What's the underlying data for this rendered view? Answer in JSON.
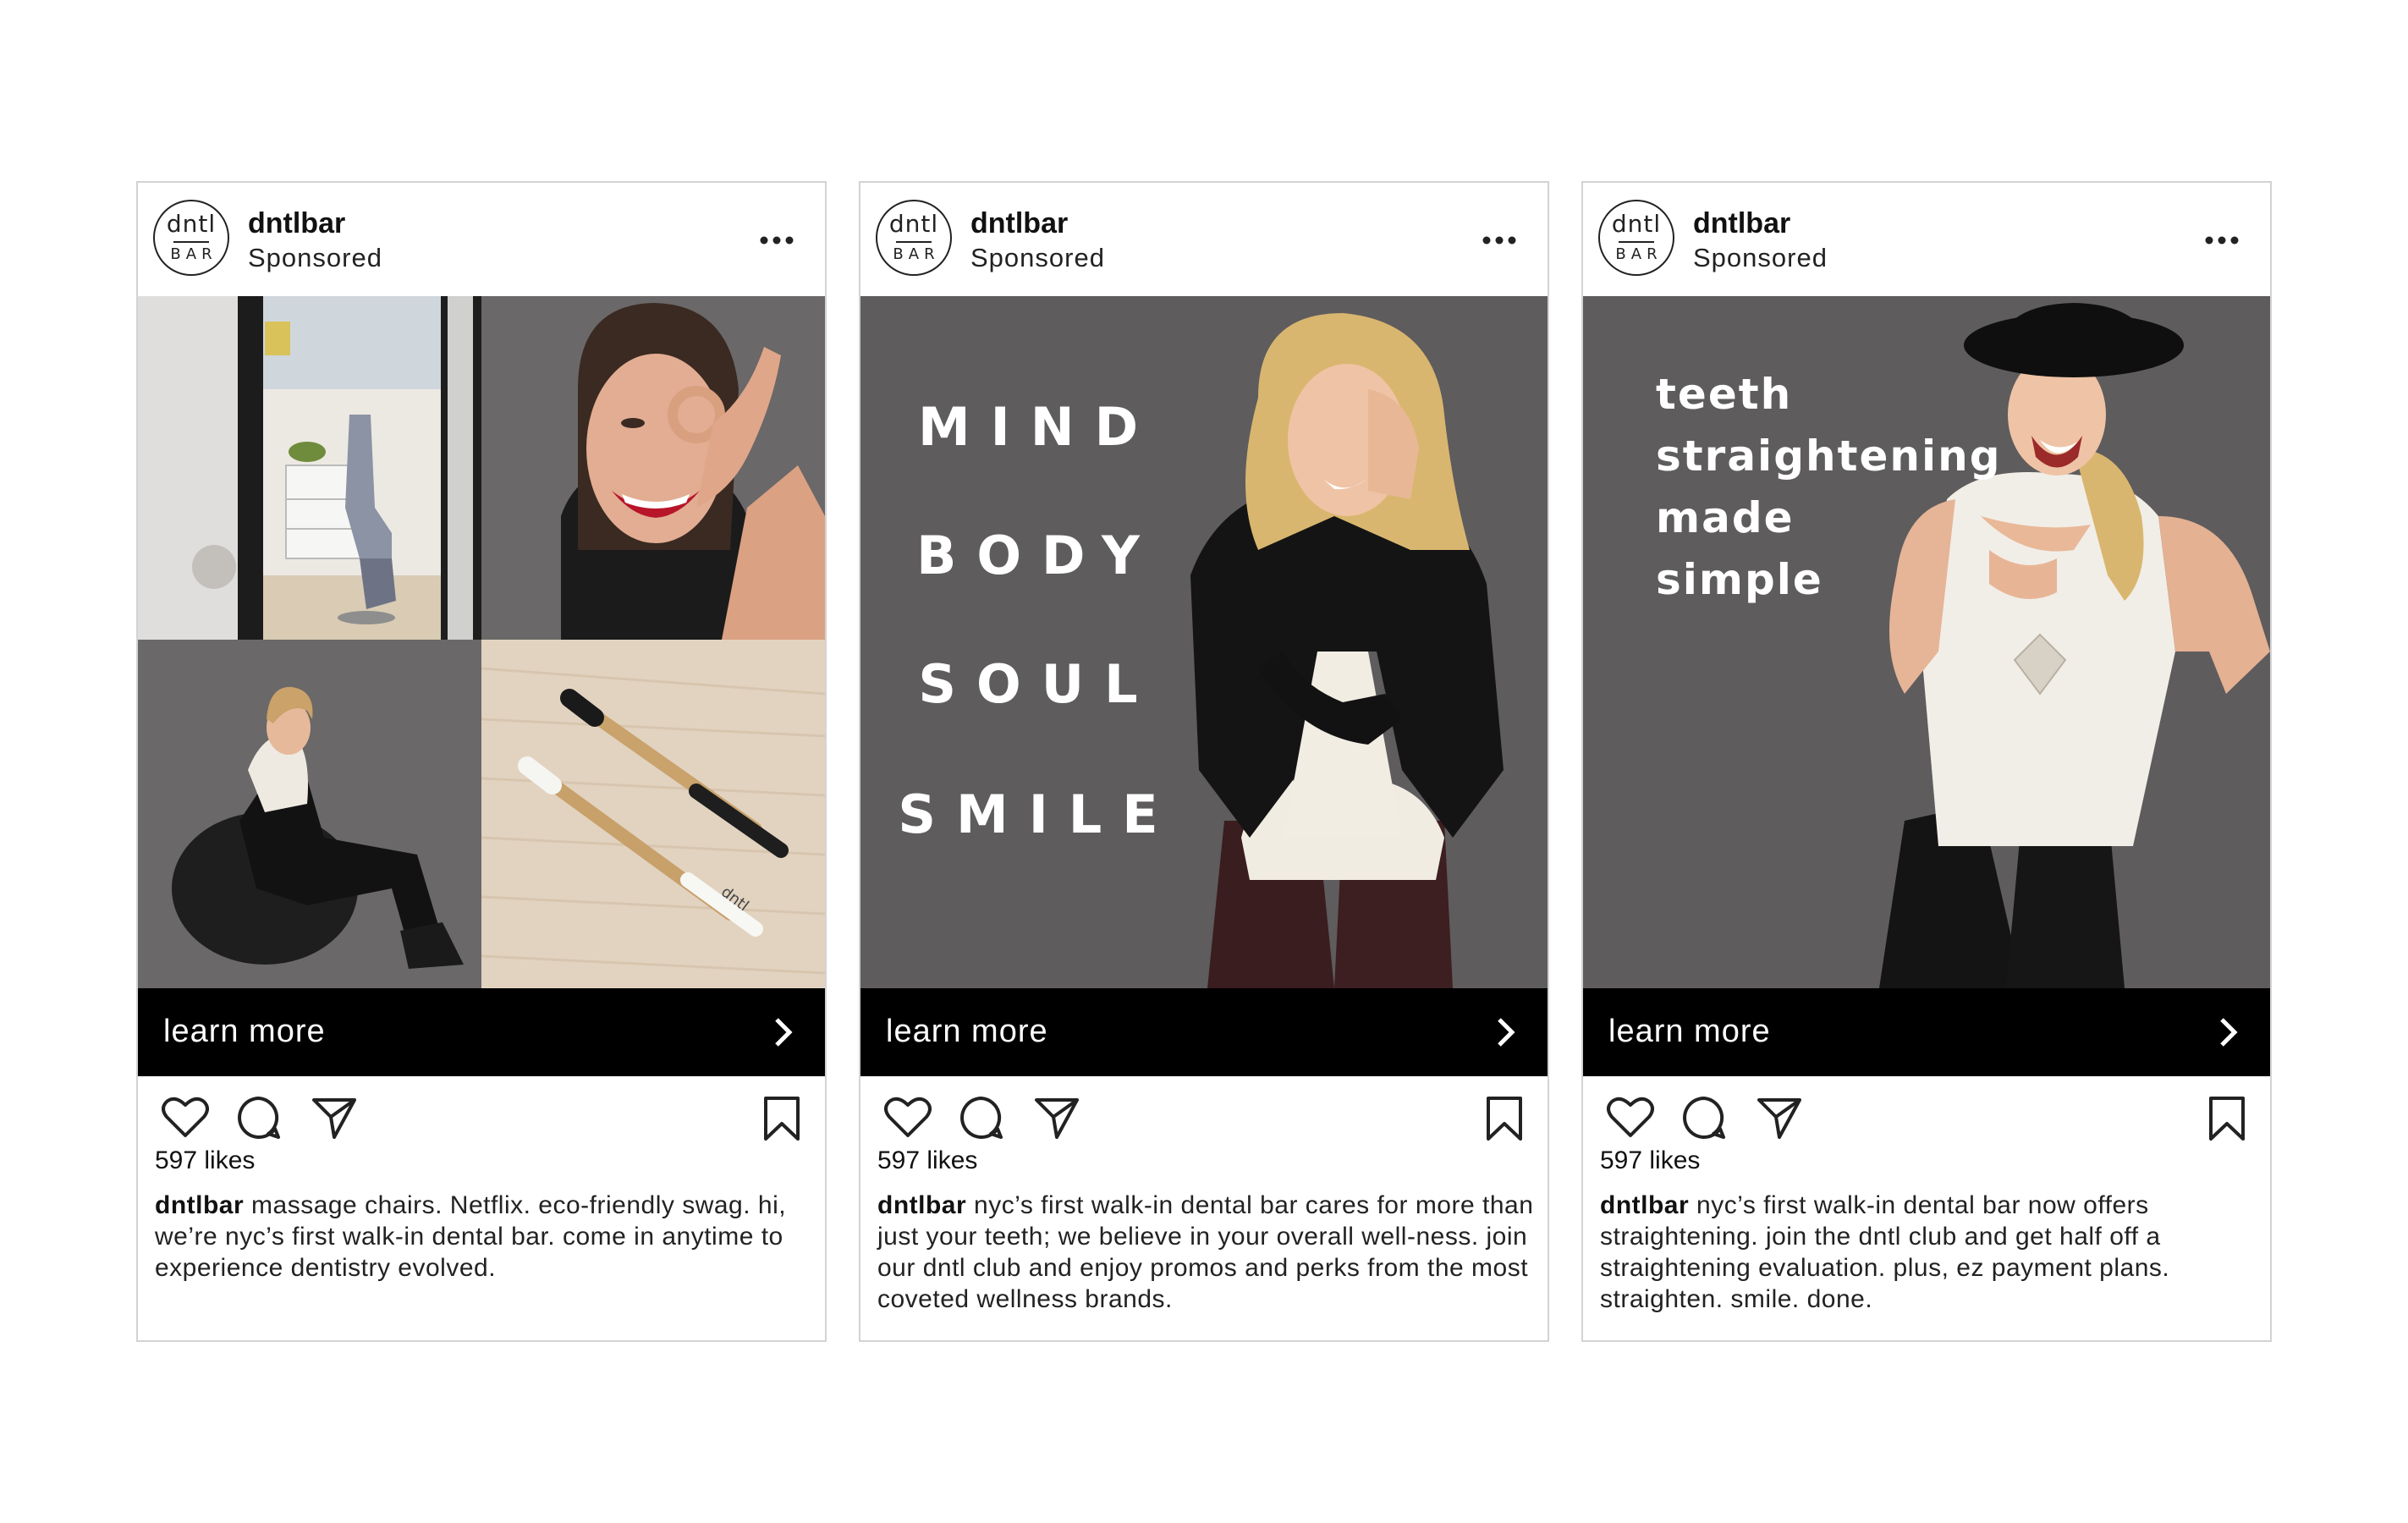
{
  "posts": [
    {
      "account": {
        "name": "dntlbar",
        "sponsored": "Sponsored",
        "logo_top": "dntl",
        "logo_bottom": "BAR"
      },
      "cta": "learn more",
      "likes": "597 likes",
      "caption_user": "dntlbar",
      "caption_text": "massage chairs. Netflix. eco-friendly swag. hi, we’re nyc’s first walk-in dental bar. come in anytime to experience dentistry evolved.",
      "toothbrush_label": "dntl",
      "photo": "collage: dental office, smiling woman, seated woman, bamboo toothbrushes"
    },
    {
      "account": {
        "name": "dntlbar",
        "sponsored": "Sponsored",
        "logo_top": "dntl",
        "logo_bottom": "BAR"
      },
      "cta": "learn more",
      "likes": "597 likes",
      "caption_user": "dntlbar",
      "caption_text": "nyc’s first walk-in dental bar cares for more than just your teeth; we believe in your overall well-ness. join our dntl club and enjoy promos and perks from the most coveted wellness brands.",
      "overlay_lines": [
        "MIND",
        "BODY",
        "SOUL",
        "SMILE"
      ]
    },
    {
      "account": {
        "name": "dntlbar",
        "sponsored": "Sponsored",
        "logo_top": "dntl",
        "logo_bottom": "BAR"
      },
      "cta": "learn more",
      "likes": "597 likes",
      "caption_user": "dntlbar",
      "caption_text": "nyc’s first walk-in dental bar now offers straightening. join the dntl club and get half off a straightening evaluation. plus, ez payment plans. straighten. smile. done.",
      "overlay_lines": [
        "teeth",
        "straightening",
        "made",
        "simple"
      ]
    }
  ],
  "icons": {
    "more": "more-options-icon",
    "like": "heart-icon",
    "comment": "comment-icon",
    "share": "send-icon",
    "save": "bookmark-icon",
    "cta": "chevron-right-icon"
  },
  "colors": {
    "photo_background": "#5f5d5e",
    "cta_background": "#000000",
    "card_border": "#d3d3d3"
  }
}
